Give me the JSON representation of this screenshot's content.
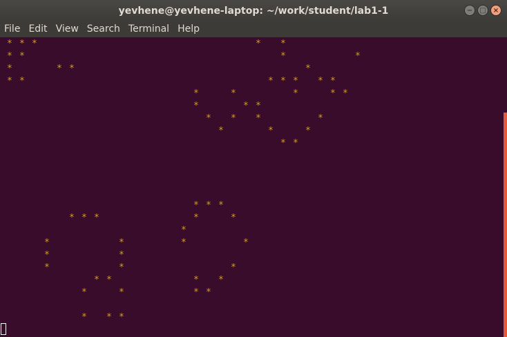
{
  "window": {
    "title": "yevhene@yevhene-laptop: ~/work/student/lab1-1",
    "controls": {
      "minimize": "−",
      "maximize": "□",
      "close": "×"
    }
  },
  "menu": {
    "items": [
      "File",
      "Edit",
      "View",
      "Search",
      "Terminal",
      "Help"
    ]
  },
  "terminal": {
    "glyph": "*",
    "star_color": "#d4a017",
    "background": "#380c2a",
    "scrollbar_color": "#e05c3c"
  }
}
